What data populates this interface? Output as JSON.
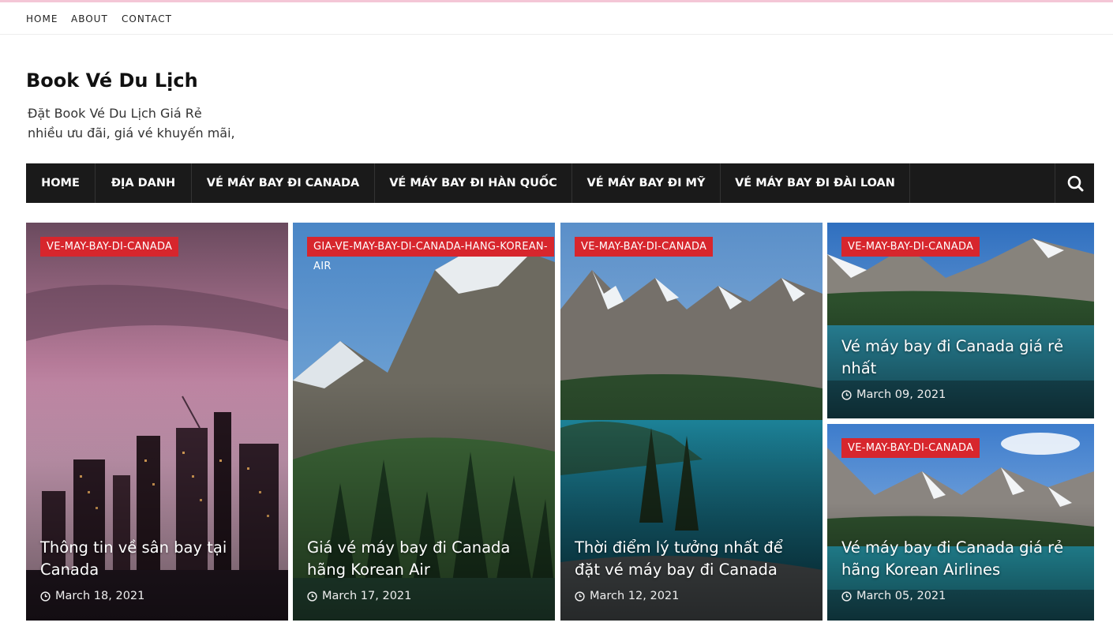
{
  "topnav": [
    "HOME",
    "ABOUT",
    "CONTACT"
  ],
  "site": {
    "title": "Book Vé Du Lịch",
    "tagline_1": "Đặt Book Vé Du Lịch Giá Rẻ",
    "tagline_2": "nhiều ưu đãi, giá vé khuyến mãi,"
  },
  "mainnav": [
    "HOME",
    "ĐỊA DANH",
    "VÉ MÁY BAY ĐI CANADA",
    "VÉ MÁY BAY ĐI HÀN QUỐC",
    "VÉ MÁY BAY ĐI MỸ",
    "VÉ MÁY BAY ĐI ĐÀI LOAN"
  ],
  "search_icon": "search-icon",
  "posts": [
    {
      "category": "VE-MAY-BAY-DI-CANADA",
      "title": "Thông tin về sân bay tại Canada",
      "date": "March 18, 2021"
    },
    {
      "category": "GIA-VE-MAY-BAY-DI-CANADA-HANG-KOREAN-AIR",
      "title": "Giá vé máy bay đi Canada hãng Korean Air",
      "date": "March 17, 2021"
    },
    {
      "category": "VE-MAY-BAY-DI-CANADA",
      "title": "Thời điểm lý tưởng nhất để đặt vé máy bay đi Canada",
      "date": "March 12, 2021"
    },
    {
      "category": "VE-MAY-BAY-DI-CANADA",
      "title": "Vé máy bay đi Canada giá rẻ nhất",
      "date": "March 09, 2021"
    },
    {
      "category": "VE-MAY-BAY-DI-CANADA",
      "title": "Vé máy bay đi Canada giá rẻ hãng Korean Airlines",
      "date": "March 05, 2021"
    }
  ],
  "colors": {
    "accent": "#d7262d",
    "nav_bg": "#1a1a1a",
    "top_border": "#f4c6d6"
  }
}
